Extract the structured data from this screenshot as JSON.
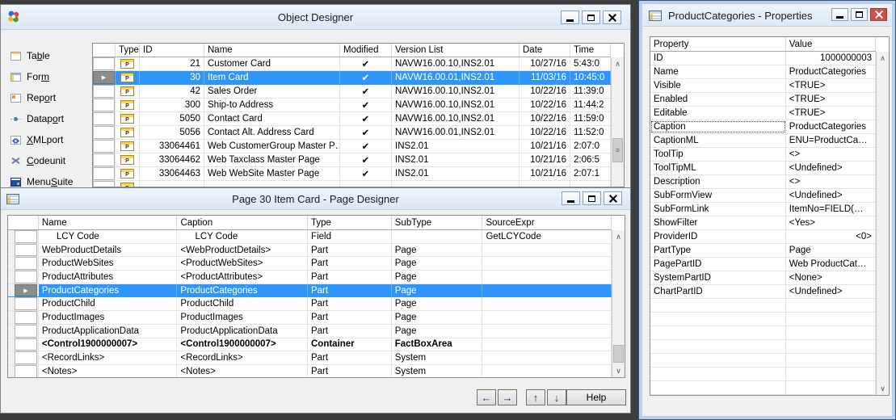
{
  "colors": {
    "selection": "#2e96fa",
    "close_button": "#cd5145",
    "titlebar": "#e4edf9",
    "desktop": "#3d3d40"
  },
  "glyphs": {
    "row_pointer": "▶",
    "page_object_letter": "P",
    "check": "✔",
    "scroll_up": "∧",
    "scroll_down": "∨",
    "grip": "≡",
    "arrow_left": "←",
    "arrow_right": "→",
    "arrow_up": "↑",
    "arrow_down": "↓"
  },
  "object_designer": {
    "title": "Object Designer",
    "sidebar_items": [
      {
        "name": "table",
        "icon": "table-icon",
        "pre": "Ta",
        "key": "b",
        "post": "le"
      },
      {
        "name": "form",
        "icon": "form-icon",
        "pre": "For",
        "key": "m",
        "post": ""
      },
      {
        "name": "report",
        "icon": "report-icon",
        "pre": "Rep",
        "key": "o",
        "post": "rt"
      },
      {
        "name": "dataport",
        "icon": "dataport-icon",
        "pre": "Datap",
        "key": "o",
        "post": "rt"
      },
      {
        "name": "xmlport",
        "icon": "xmlport-icon",
        "pre": "",
        "key": "X",
        "post": "MLport"
      },
      {
        "name": "codeunit",
        "icon": "codeunit-icon",
        "pre": "",
        "key": "C",
        "post": "odeunit"
      },
      {
        "name": "menusuite",
        "icon": "menusuite-icon",
        "pre": "Menu",
        "key": "S",
        "post": "uite"
      }
    ],
    "columns": {
      "sel": "",
      "type": "Type",
      "id": "ID",
      "name": "Name",
      "modified": "Modified",
      "version": "Version List",
      "date": "Date",
      "time": "Time"
    },
    "rows": [
      {
        "id": "21",
        "name": "Customer Card",
        "modified": "✔",
        "version": "NAVW16.00.10,INS2.01",
        "date": "10/27/16",
        "time": "5:43:0"
      },
      {
        "id": "30",
        "name": "Item Card",
        "modified": "✔",
        "version": "NAVW16.00.01,INS2.01",
        "date": "11/03/16",
        "time": "10:45:0",
        "selected": true
      },
      {
        "id": "42",
        "name": "Sales Order",
        "modified": "✔",
        "version": "NAVW16.00.10,INS2.01",
        "date": "10/22/16",
        "time": "11:39:0"
      },
      {
        "id": "300",
        "name": "Ship-to Address",
        "modified": "✔",
        "version": "NAVW16.00.10,INS2.01",
        "date": "10/22/16",
        "time": "11:44:2"
      },
      {
        "id": "5050",
        "name": "Contact Card",
        "modified": "✔",
        "version": "NAVW16.00.10,INS2.01",
        "date": "10/22/16",
        "time": "11:59:0"
      },
      {
        "id": "5056",
        "name": "Contact Alt. Address Card",
        "modified": "✔",
        "version": "NAVW16.00.01,INS2.01",
        "date": "10/22/16",
        "time": "11:52:0"
      },
      {
        "id": "33064461",
        "name": "Web CustomerGroup Master P…",
        "modified": "✔",
        "version": "INS2.01",
        "date": "10/21/16",
        "time": "2:07:0"
      },
      {
        "id": "33064462",
        "name": "Web Taxclass Master Page",
        "modified": "✔",
        "version": "INS2.01",
        "date": "10/21/16",
        "time": "2:06:5"
      },
      {
        "id": "33064463",
        "name": "Web WebSite Master Page",
        "modified": "✔",
        "version": "INS2.01",
        "date": "10/21/16",
        "time": "2:07:1"
      }
    ]
  },
  "page_designer": {
    "title": "Page 30 Item Card - Page Designer",
    "columns": {
      "sel": "",
      "name": "Name",
      "caption": "Caption",
      "type": "Type",
      "subtype": "SubType",
      "source": "SourceExpr"
    },
    "rows": [
      {
        "name": "LCY Code",
        "caption": "LCY Code",
        "type": "Field",
        "subtype": "",
        "source": "GetLCYCode",
        "indent": true
      },
      {
        "name": "WebProductDetails",
        "caption": "<WebProductDetails>",
        "type": "Part",
        "subtype": "Page",
        "source": ""
      },
      {
        "name": "ProductWebSites",
        "caption": "<ProductWebSites>",
        "type": "Part",
        "subtype": "Page",
        "source": ""
      },
      {
        "name": "ProductAttributes",
        "caption": "<ProductAttributes>",
        "type": "Part",
        "subtype": "Page",
        "source": ""
      },
      {
        "name": "ProductCategories",
        "caption": "ProductCategories",
        "type": "Part",
        "subtype": "Page",
        "source": "",
        "selected": true
      },
      {
        "name": "ProductChild",
        "caption": "ProductChild",
        "type": "Part",
        "subtype": "Page",
        "source": ""
      },
      {
        "name": "ProductImages",
        "caption": "ProductImages",
        "type": "Part",
        "subtype": "Page",
        "source": ""
      },
      {
        "name": "ProductApplicationData",
        "caption": "ProductApplicationData",
        "type": "Part",
        "subtype": "Page",
        "source": ""
      },
      {
        "name": "<Control1900000007>",
        "caption": "<Control1900000007>",
        "type": "Container",
        "subtype": "FactBoxArea",
        "source": "",
        "bold": true
      },
      {
        "name": "<RecordLinks>",
        "caption": "<RecordLinks>",
        "type": "Part",
        "subtype": "System",
        "source": ""
      },
      {
        "name": "<Notes>",
        "caption": "<Notes>",
        "type": "Part",
        "subtype": "System",
        "source": ""
      }
    ],
    "footer": {
      "help_label": "Help"
    }
  },
  "properties": {
    "title": "ProductCategories - Properties",
    "columns": {
      "property": "Property",
      "value": "Value"
    },
    "rows": [
      {
        "property": "ID",
        "value": "1000000003",
        "align": "right"
      },
      {
        "property": "Name",
        "value": "ProductCategories"
      },
      {
        "property": "Visible",
        "value": "<TRUE>"
      },
      {
        "property": "Enabled",
        "value": "<TRUE>"
      },
      {
        "property": "Editable",
        "value": "<TRUE>"
      },
      {
        "property": "Caption",
        "value": "ProductCategories",
        "focused": true
      },
      {
        "property": "CaptionML",
        "value": "ENU=ProductCa…"
      },
      {
        "property": "ToolTip",
        "value": "<>"
      },
      {
        "property": "ToolTipML",
        "value": "<Undefined>"
      },
      {
        "property": "Description",
        "value": "<>"
      },
      {
        "property": "SubFormView",
        "value": "<Undefined>"
      },
      {
        "property": "SubFormLink",
        "value": "ItemNo=FIELD(…"
      },
      {
        "property": "ShowFilter",
        "value": "<Yes>"
      },
      {
        "property": "ProviderID",
        "value": "<0>",
        "align": "right"
      },
      {
        "property": "PartType",
        "value": "Page"
      },
      {
        "property": "PagePartID",
        "value": "Web ProductCat…"
      },
      {
        "property": "SystemPartID",
        "value": "<None>"
      },
      {
        "property": "ChartPartID",
        "value": "<Undefined>"
      }
    ]
  }
}
